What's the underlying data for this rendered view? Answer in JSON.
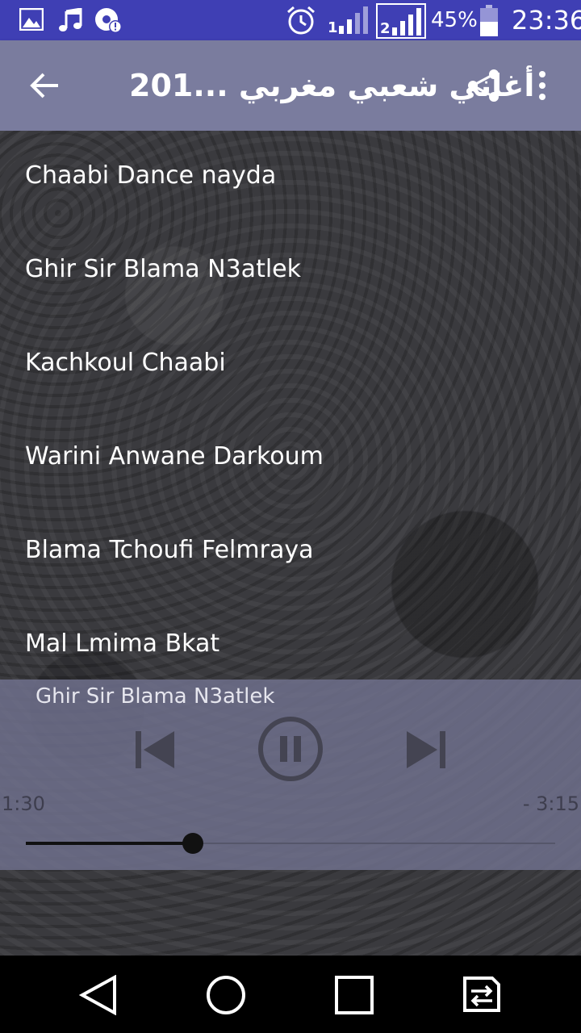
{
  "status_bar": {
    "battery_percent": "45%",
    "time": "23:36",
    "icons": [
      "image-icon",
      "music-icon",
      "chrome-alert-icon",
      "alarm-icon",
      "signal-sim1-icon",
      "signal-sim2-icon",
      "battery-icon"
    ]
  },
  "app_bar": {
    "title": "أغاني شعبي مغربي ...201",
    "icons": [
      "back-arrow-icon",
      "share-icon",
      "more-vert-icon"
    ]
  },
  "songs": [
    "Chaabi Dance nayda",
    "Ghir Sir Blama N3atlek",
    "Kachkoul Chaabi",
    "Warini Anwane Darkoum",
    "Blama Tchoufi Felmraya",
    "Mal Lmima Bkat"
  ],
  "player": {
    "now_playing": "Ghir Sir Blama N3atlek",
    "elapsed": "1:30",
    "remaining": "- 3:15",
    "progress_fraction": 0.315,
    "icons": [
      "skip-previous-icon",
      "pause-icon",
      "skip-next-icon"
    ]
  },
  "nav_bar": {
    "icons": [
      "back-triangle-icon",
      "home-circle-icon",
      "recents-square-icon",
      "sim-switch-icon"
    ]
  }
}
